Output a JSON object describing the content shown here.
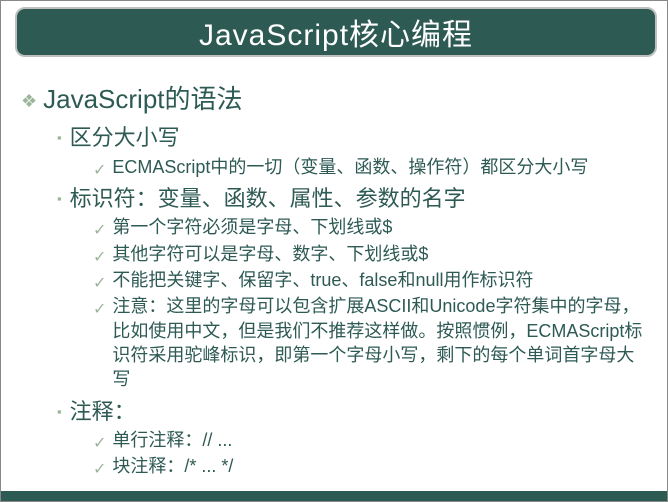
{
  "title": "JavaScript核心编程",
  "section": {
    "heading": "JavaScript的语法",
    "items": [
      {
        "label": "区分大小写",
        "points": [
          "ECMAScript中的一切（变量、函数、操作符）都区分大小写"
        ]
      },
      {
        "label": "标识符：变量、函数、属性、参数的名字",
        "points": [
          "第一个字符必须是字母、下划线或$",
          "其他字符可以是字母、数字、下划线或$",
          "不能把关键字、保留字、true、false和null用作标识符",
          "注意：这里的字母可以包含扩展ASCII和Unicode字符集中的字母，比如使用中文，但是我们不推荐这样做。按照惯例，ECMAScript标识符采用驼峰标识，即第一个字母小写，剩下的每个单词首字母大写"
        ]
      },
      {
        "label": "注释：",
        "points": [
          "单行注释：// ...",
          "块注释：/* ... */"
        ]
      }
    ]
  }
}
